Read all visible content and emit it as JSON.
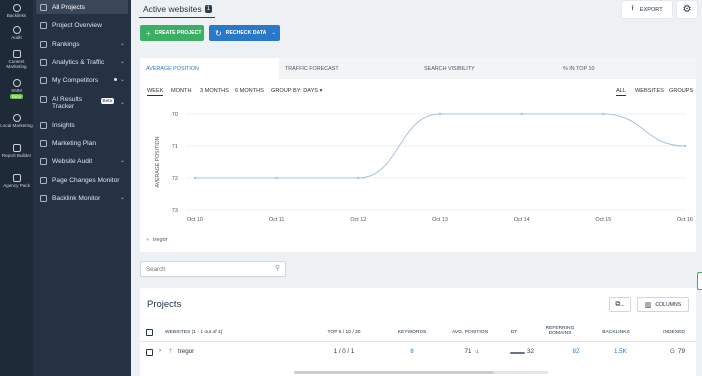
{
  "rail": [
    {
      "label": "Backlinks",
      "icon": "link-icon"
    },
    {
      "label": "Audit",
      "icon": "audit-icon"
    },
    {
      "label": "Content Marketing",
      "icon": "content-icon"
    },
    {
      "label": "SMM",
      "icon": "smm-icon",
      "badge": "Beta"
    },
    {
      "label": "Local Marketing",
      "icon": "location-icon"
    },
    {
      "label": "Report Builder",
      "icon": "report-icon"
    },
    {
      "label": "Agency Pack",
      "icon": "agency-icon"
    }
  ],
  "sidebar": {
    "items": [
      {
        "label": "All Projects"
      },
      {
        "label": "Project Overview"
      },
      {
        "label": "Rankings"
      },
      {
        "label": "Analytics & Traffic"
      },
      {
        "label": "My Competitors"
      },
      {
        "label": "AI Results Tracker",
        "badge": "Beta"
      },
      {
        "label": "Insights"
      },
      {
        "label": "Marketing Plan"
      },
      {
        "label": "Website Audit"
      },
      {
        "label": "Page Changes Monitor"
      },
      {
        "label": "Backlink Monitor"
      }
    ]
  },
  "header": {
    "title": "Active websites",
    "count": "1",
    "export_label": "EXPORT"
  },
  "actions": {
    "create_label": "CREATE PROJECT",
    "recheck_label": "RECHECK DATA"
  },
  "chart_panel": {
    "tabs": [
      "AVERAGE POSITION",
      "TRAFFIC FORECAST",
      "SEARCH VISIBILITY",
      "% IN TOP 10"
    ],
    "periods": [
      "WEEK",
      "MONTH",
      "3 MONTHS",
      "6 MONTHS"
    ],
    "group_by": "GROUP BY: DAYS",
    "filters": [
      "ALL",
      "WEBSITES",
      "GROUPS"
    ]
  },
  "chart_data": {
    "type": "line",
    "x": [
      "Oct 10",
      "Oct 11",
      "Oct 12",
      "Oct 13",
      "Oct 14",
      "Oct 15",
      "Oct 16"
    ],
    "series": [
      {
        "name": "tregor",
        "values": [
          72,
          72,
          72,
          70,
          70,
          70,
          71
        ]
      }
    ],
    "ylabel": "AVERAGE POSITION",
    "y_ticks": [
      "70",
      "71",
      "72",
      "73"
    ],
    "ylim": [
      73,
      70
    ],
    "y_inverted": true,
    "grid": true,
    "color": "#a8c2dd"
  },
  "search": {
    "placeholder": "Search"
  },
  "projects": {
    "title": "Projects",
    "columns_label": "COLUMNS",
    "headers": [
      "WEBSITES (1 - 1 out of 1)",
      "TOP 5 / 10 / 30",
      "KEYWORDS",
      "AVG. POSITION",
      "DT",
      "REFERRING DOMAINS",
      "BACKLINKS",
      "INDEXED"
    ],
    "rows": [
      {
        "website": "tregor",
        "top": "1 / 0 / 1",
        "keywords": "8",
        "avg_position": "71",
        "avg_change": "↑1",
        "dt": "32",
        "referring_domains": "82",
        "backlinks": "1.5K",
        "indexed": "79"
      }
    ]
  },
  "colors": {
    "accent": "#2a79c9",
    "success": "#3daf65",
    "sidebar": "#253243",
    "rail": "#1f2a38"
  }
}
